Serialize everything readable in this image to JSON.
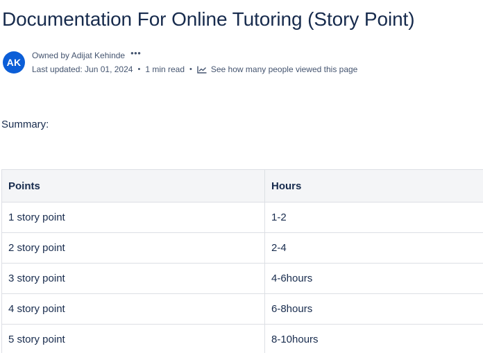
{
  "page": {
    "title": "Documentation For Online Tutoring (Story Point)"
  },
  "byline": {
    "avatar_initials": "AK",
    "owner_text": "Owned by Adijat Kehinde",
    "more_icon": "ellipsis-icon",
    "last_updated": "Last updated: Jun 01, 2024",
    "read_time": "1 min read",
    "separator": "•",
    "analytics_icon": "analytics-icon",
    "views_link": "See how many people viewed this page"
  },
  "content": {
    "summary": "Summary:",
    "table": {
      "headers": [
        "Points",
        "Hours"
      ],
      "rows": [
        [
          "1 story point",
          "1-2"
        ],
        [
          "2 story point",
          "2-4"
        ],
        [
          "3 story point",
          "4-6hours"
        ],
        [
          "4 story point",
          "6-8hours"
        ],
        [
          "5 story point",
          "8-10hours"
        ]
      ]
    }
  },
  "colors": {
    "avatar_bg": "#0b5ed7",
    "text": "#172b4d",
    "subtle_text": "#44546f",
    "header_bg": "#f4f5f7",
    "border": "#dcdfe4"
  }
}
